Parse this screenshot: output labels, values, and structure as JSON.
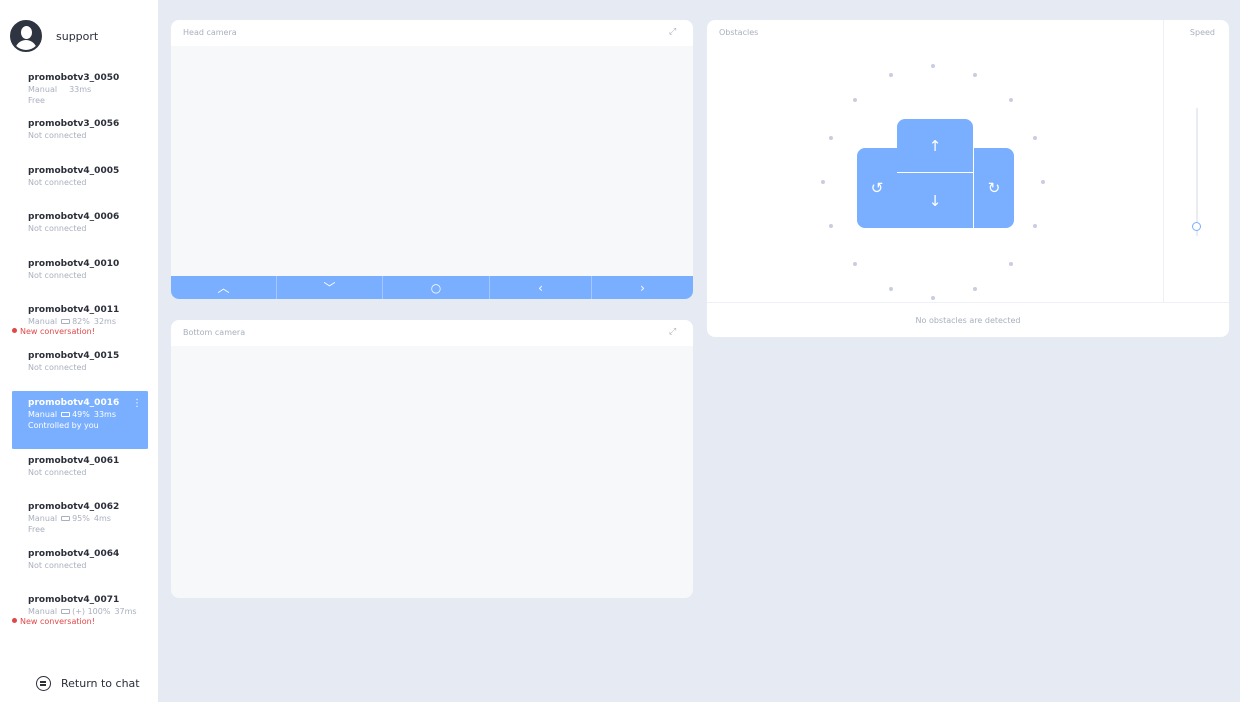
{
  "user": {
    "name": "support"
  },
  "robots": [
    {
      "name": "promobotv3_0050",
      "mode": "Manual",
      "battery": "",
      "ping": "33ms",
      "state": "Free",
      "alert": ""
    },
    {
      "name": "promobotv3_0056",
      "mode": "",
      "battery": "",
      "ping": "",
      "state": "Not connected",
      "alert": ""
    },
    {
      "name": "promobotv4_0005",
      "mode": "",
      "battery": "",
      "ping": "",
      "state": "Not connected",
      "alert": ""
    },
    {
      "name": "promobotv4_0006",
      "mode": "",
      "battery": "",
      "ping": "",
      "state": "Not connected",
      "alert": ""
    },
    {
      "name": "promobotv4_0010",
      "mode": "",
      "battery": "",
      "ping": "",
      "state": "Not connected",
      "alert": ""
    },
    {
      "name": "promobotv4_0011",
      "mode": "Manual",
      "battery": "82%",
      "ping": "32ms",
      "state": "",
      "alert": "New conversation!"
    },
    {
      "name": "promobotv4_0015",
      "mode": "",
      "battery": "",
      "ping": "",
      "state": "Not connected",
      "alert": ""
    },
    {
      "name": "promobotv4_0016",
      "mode": "Manual",
      "battery": "49%",
      "ping": "33ms",
      "state": "Controlled by you",
      "alert": "",
      "active": true
    },
    {
      "name": "promobotv4_0061",
      "mode": "",
      "battery": "",
      "ping": "",
      "state": "Not connected",
      "alert": ""
    },
    {
      "name": "promobotv4_0062",
      "mode": "Manual",
      "battery": "95%",
      "ping": "4ms",
      "state": "Free",
      "alert": ""
    },
    {
      "name": "promobotv4_0064",
      "mode": "",
      "battery": "",
      "ping": "",
      "state": "Not connected",
      "alert": ""
    },
    {
      "name": "promobotv4_0071",
      "mode": "Manual",
      "battery": "(+) 100%",
      "ping": "37ms",
      "state": "",
      "alert": "New conversation!"
    }
  ],
  "sidebar": {
    "return_label": "Return to chat"
  },
  "head_camera": {
    "title": "Head camera",
    "controls": [
      {
        "name": "tilt-up",
        "glyph": "︿"
      },
      {
        "name": "tilt-down",
        "glyph": "﹀"
      },
      {
        "name": "center",
        "glyph": "○"
      },
      {
        "name": "pan-left",
        "glyph": "‹"
      },
      {
        "name": "pan-right",
        "glyph": "›"
      }
    ]
  },
  "bottom_camera": {
    "title": "Bottom camera"
  },
  "obstacles": {
    "title": "Obstacles",
    "speed_title": "Speed",
    "status": "No obstacles are detected",
    "speed_level": 0.08,
    "dpad": {
      "forward": "↑",
      "backward": "↓",
      "rotate_left": "↺",
      "rotate_right": "↻"
    }
  },
  "colors": {
    "accent": "#7aafff",
    "alert": "#e04848",
    "muted": "#a9afbd",
    "background": "#e6eaf3"
  }
}
